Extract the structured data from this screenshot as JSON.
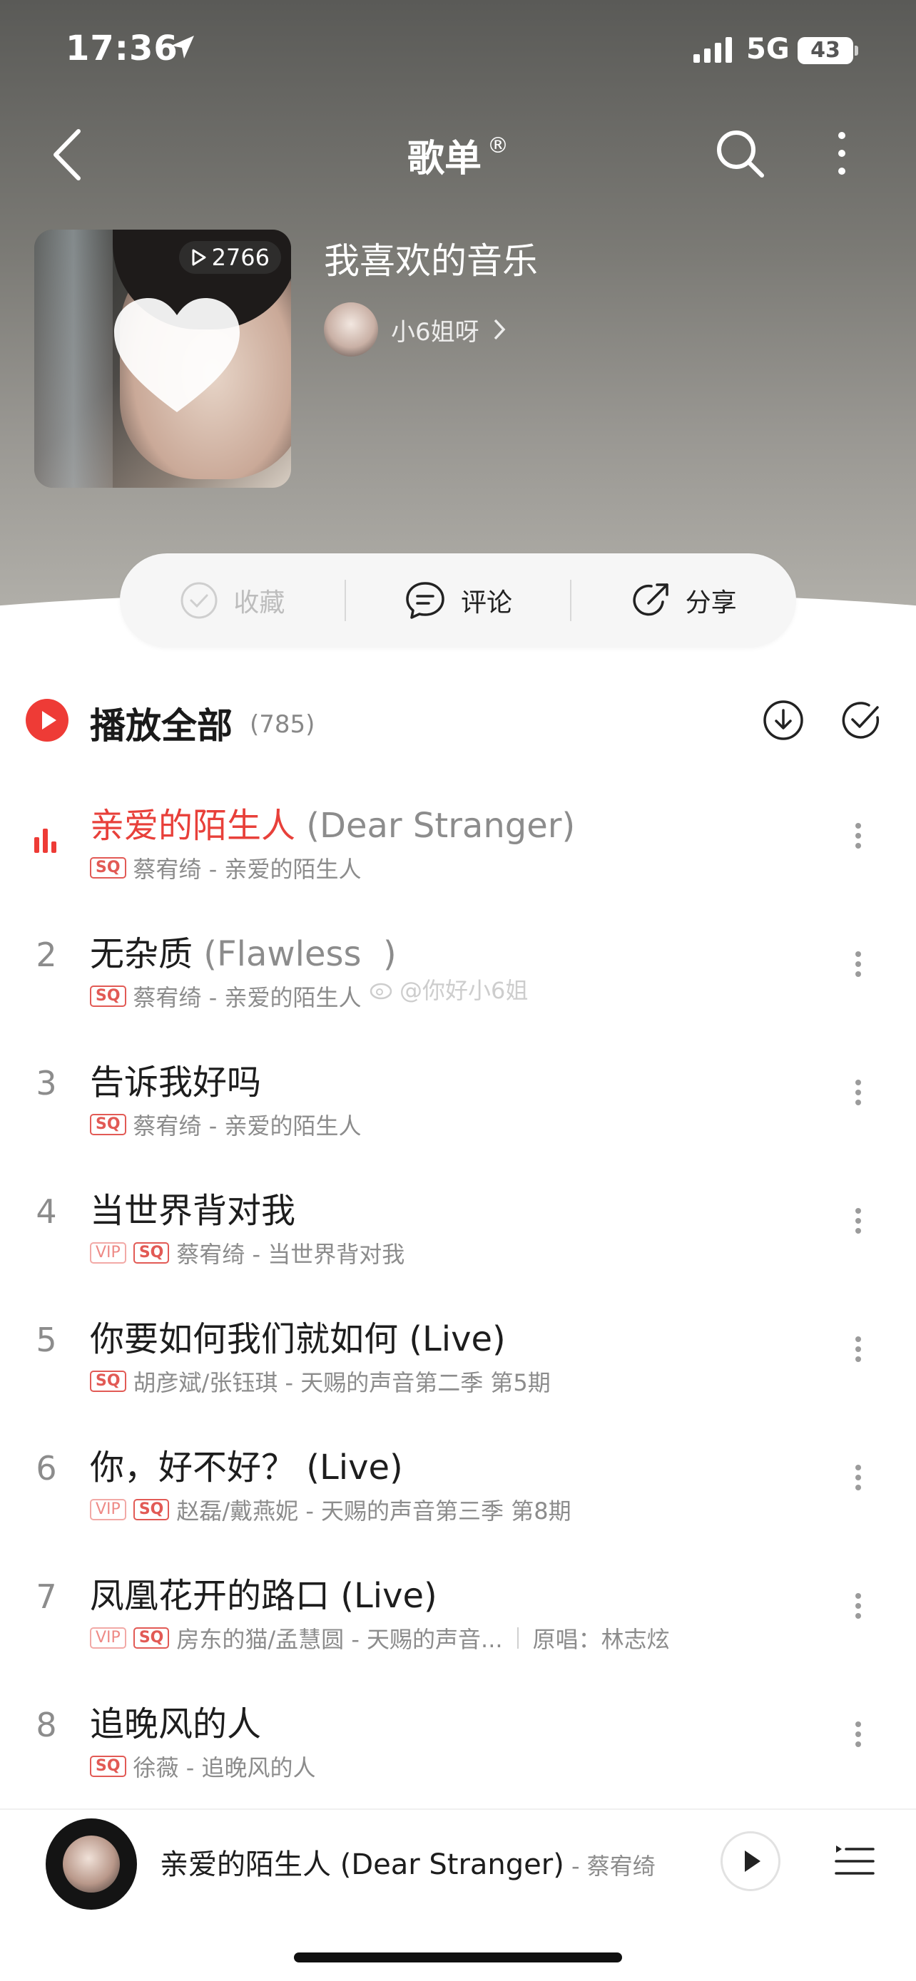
{
  "status_bar": {
    "time": "17:36",
    "network": "5G",
    "battery": "43"
  },
  "nav": {
    "title": "歌单",
    "title_mark": "®"
  },
  "playlist": {
    "play_count": "2766",
    "name": "我喜欢的音乐",
    "creator": "小6姐呀"
  },
  "actions": {
    "collect": "收藏",
    "comment": "评论",
    "share": "分享"
  },
  "play_all": {
    "label": "播放全部",
    "count": "(785)"
  },
  "songs": [
    {
      "index": "",
      "title": "亲爱的陌生人",
      "title_alt": " (Dear Stranger)",
      "tags": [
        "SQ"
      ],
      "meta": "蔡宥绮 - 亲爱的陌生人",
      "original": "",
      "playing": true
    },
    {
      "index": "2",
      "title": "无杂质",
      "title_alt": " (Flawless  )",
      "tags": [
        "SQ"
      ],
      "meta": "蔡宥绮 - 亲爱的陌生人",
      "original": ""
    },
    {
      "index": "3",
      "title": "告诉我好吗",
      "title_alt": "",
      "tags": [
        "SQ"
      ],
      "meta": "蔡宥绮 - 亲爱的陌生人",
      "original": ""
    },
    {
      "index": "4",
      "title": "当世界背对我",
      "title_alt": "",
      "tags": [
        "VIP",
        "SQ"
      ],
      "meta": "蔡宥绮 - 当世界背对我",
      "original": ""
    },
    {
      "index": "5",
      "title": "你要如何我们就如何 (Live)",
      "title_alt": "",
      "tags": [
        "SQ"
      ],
      "meta": "胡彦斌/张钰琪 - 天赐的声音第二季 第5期",
      "original": ""
    },
    {
      "index": "6",
      "title": "你，好不好？ (Live)",
      "title_alt": "",
      "tags": [
        "VIP",
        "SQ"
      ],
      "meta": "赵磊/戴燕妮 - 天赐的声音第三季 第8期",
      "original": ""
    },
    {
      "index": "7",
      "title": "凤凰花开的路口 (Live)",
      "title_alt": "",
      "tags": [
        "VIP",
        "SQ"
      ],
      "meta": "房东的猫/孟慧圆 - 天赐的声音...",
      "original": "原唱：林志炫"
    },
    {
      "index": "8",
      "title": "追晚风的人",
      "title_alt": "",
      "tags": [
        "SQ"
      ],
      "meta": "徐薇 - 追晚风的人",
      "original": ""
    }
  ],
  "watermark": "@你好小6姐",
  "mini_player": {
    "title": "亲爱的陌生人 (Dear Stranger)",
    "artist": " - 蔡宥绮"
  },
  "colors": {
    "accent": "#ee3b36"
  }
}
